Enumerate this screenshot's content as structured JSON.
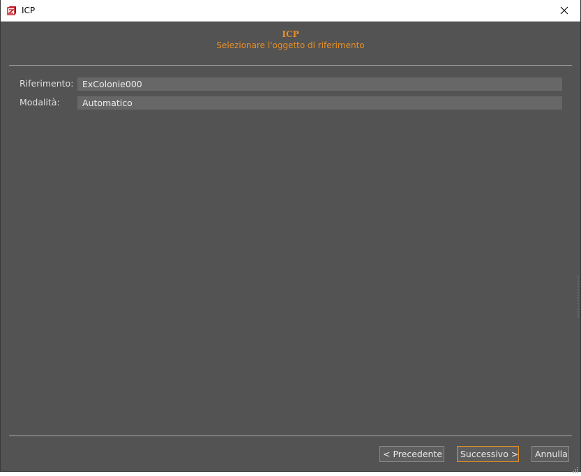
{
  "window": {
    "title": "ICP",
    "close_label": "close"
  },
  "header": {
    "title": "ICP",
    "subtitle": "Selezionare l'oggetto di riferimento"
  },
  "form": {
    "riferimento_label": "Riferimento:",
    "riferimento_value": "ExColonie000",
    "modalita_label": "Modalità:",
    "modalita_value": "Automatico"
  },
  "buttons": {
    "prev_label": "< Precedente",
    "next_label": "Successivo >",
    "cancel_label": "Annulla"
  },
  "colors": {
    "accent": "#e88f24",
    "background": "#535353",
    "field": "#676767",
    "icon_red": "#c8202a"
  },
  "icons": {
    "app": "icp-app-icon",
    "close": "close-icon",
    "resize": "resize-grip-icon"
  }
}
